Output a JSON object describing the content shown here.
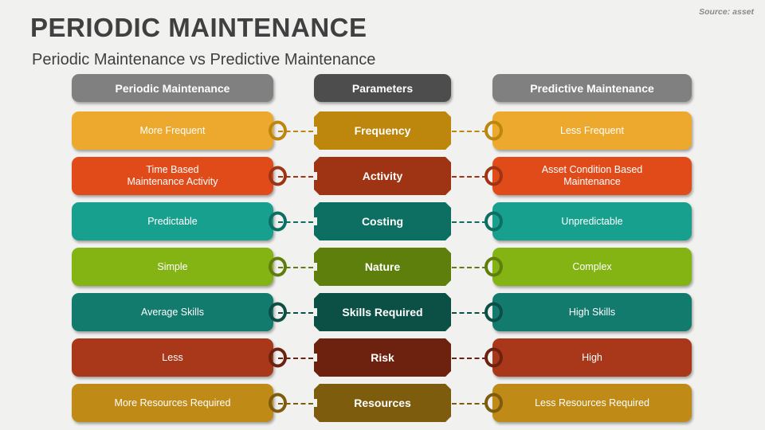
{
  "slide": {
    "title": "PERIODIC MAINTENANCE",
    "subtitle": "Periodic Maintenance vs Predictive Maintenance",
    "source": "Source: asset",
    "background_color": "#f1f1f0",
    "title_color": "#404040"
  },
  "headers": {
    "left": "Periodic Maintenance",
    "center": "Parameters",
    "right": "Predictive Maintenance",
    "side_color": "#808080",
    "center_color": "#4d4d4d"
  },
  "chart_data": {
    "type": "table",
    "title": "Periodic Maintenance vs Predictive Maintenance",
    "columns": [
      "Periodic Maintenance",
      "Parameters",
      "Predictive Maintenance"
    ],
    "rows": [
      {
        "parameter": "Frequency",
        "left": "More Frequent",
        "right": "Less Frequent",
        "side_color": "#eda92e",
        "center_color": "#bd860c"
      },
      {
        "parameter": "Activity",
        "left": "Time Based\nMaintenance Activity",
        "left_line1": "Time Based",
        "left_line2": "Maintenance Activity",
        "right": "Asset Condition Based\nMaintenance",
        "right_line1": "Asset Condition Based",
        "right_line2": "Maintenance",
        "side_color": "#e14b19",
        "center_color": "#9e3413"
      },
      {
        "parameter": "Costing",
        "left": "Predictable",
        "right": "Unpredictable",
        "side_color": "#18a08e",
        "center_color": "#0d6f62"
      },
      {
        "parameter": "Nature",
        "left": "Simple",
        "right": "Complex",
        "side_color": "#83b414",
        "center_color": "#5e7f0b"
      },
      {
        "parameter": "Skills Required",
        "left": "Average Skills",
        "right": "High Skills",
        "side_color": "#127b6e",
        "center_color": "#0b4f45"
      },
      {
        "parameter": "Risk",
        "left": "Less",
        "right": "High",
        "side_color": "#a9371a",
        "center_color": "#6d2210"
      },
      {
        "parameter": "Resources",
        "left": "More Resources Required",
        "right": "Less Resources Required",
        "side_color": "#c08a17",
        "center_color": "#7e5c0d"
      }
    ]
  }
}
